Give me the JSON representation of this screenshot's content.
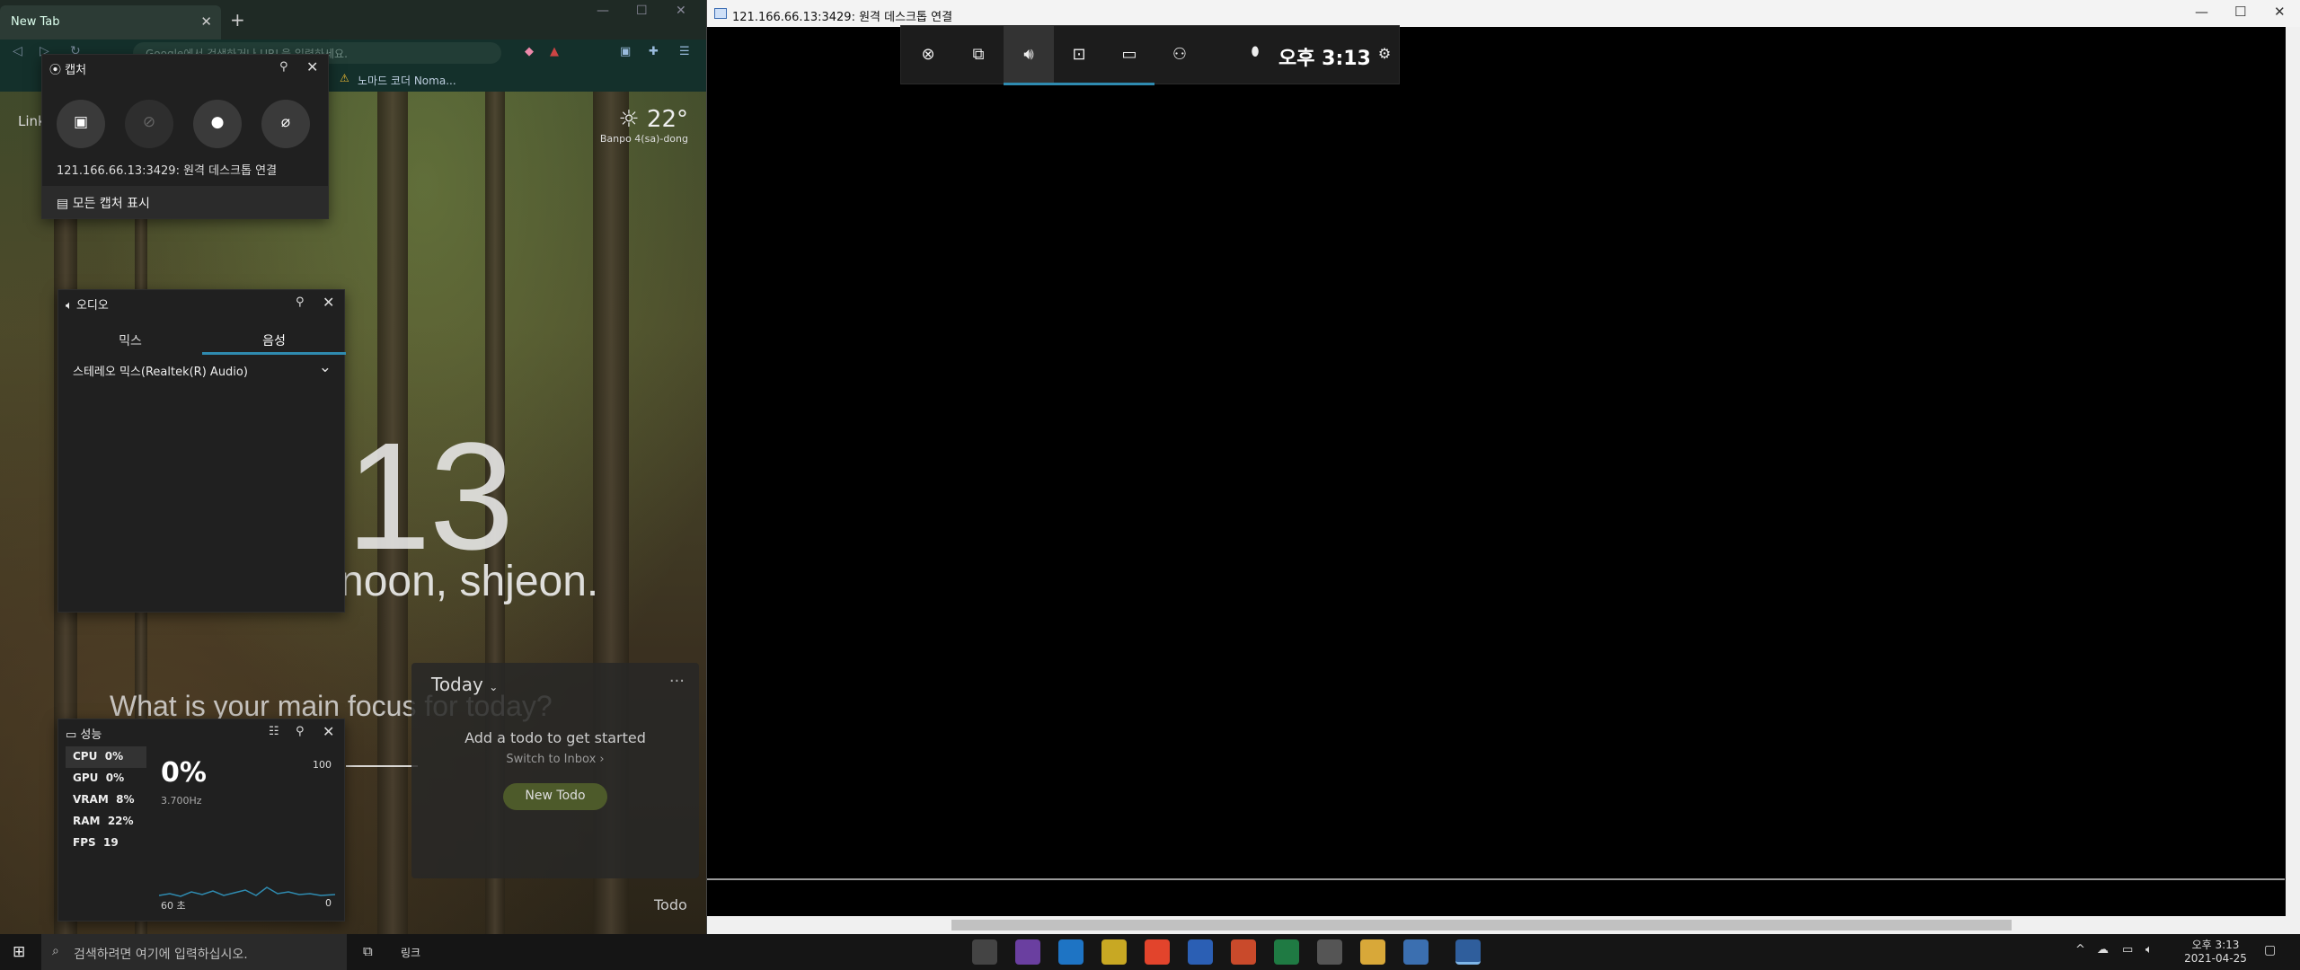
{
  "browser": {
    "tab_title": "New Tab",
    "address_placeholder": "Google에서 검색하거나 URL을 입력하세요.",
    "bookmark": "노마드 코더 Noma...",
    "links_label": "Link",
    "weather": {
      "temp": "22°",
      "location": "Banpo 4(sa)-dong"
    },
    "clock": ":13",
    "greeting": "noon, shjeon.",
    "focus_prompt": "What is your main focus for today?",
    "todo": {
      "header": "Today",
      "empty": "Add a todo to get started",
      "switch": "Switch to Inbox",
      "new_button": "New Todo",
      "panel_label": "Todo"
    }
  },
  "capture_widget": {
    "title": "캡처",
    "info": "121.166.66.13:3429: 원격 데스크톱 연결",
    "show_all": "모든 캡처 표시"
  },
  "audio_widget": {
    "title": "오디오",
    "tabs": [
      "믹스",
      "음성"
    ],
    "device": "스테레오 믹스(Realtek(R) Audio)"
  },
  "perf_widget": {
    "title": "성능",
    "rows": [
      {
        "name": "CPU",
        "value": "0%"
      },
      {
        "name": "GPU",
        "value": "0%"
      },
      {
        "name": "VRAM",
        "value": "8%"
      },
      {
        "name": "RAM",
        "value": "22%"
      },
      {
        "name": "FPS",
        "value": "19"
      }
    ],
    "big_value": "0%",
    "freq": "3.700Hz",
    "max_label": "100",
    "min_label": "0",
    "duration": "60 초"
  },
  "rdp": {
    "title": "121.166.66.13:3429: 원격 데스크톱 연결"
  },
  "gamebar": {
    "clock": "오후 3:13"
  },
  "taskbar": {
    "search_placeholder": "검색하려면 여기에 입력하십시오.",
    "link_label": "링크",
    "time": "오후 3:13",
    "date": "2021-04-25"
  },
  "colors": {
    "accent": "#2f8bb0",
    "widget_bg": "#202020"
  }
}
